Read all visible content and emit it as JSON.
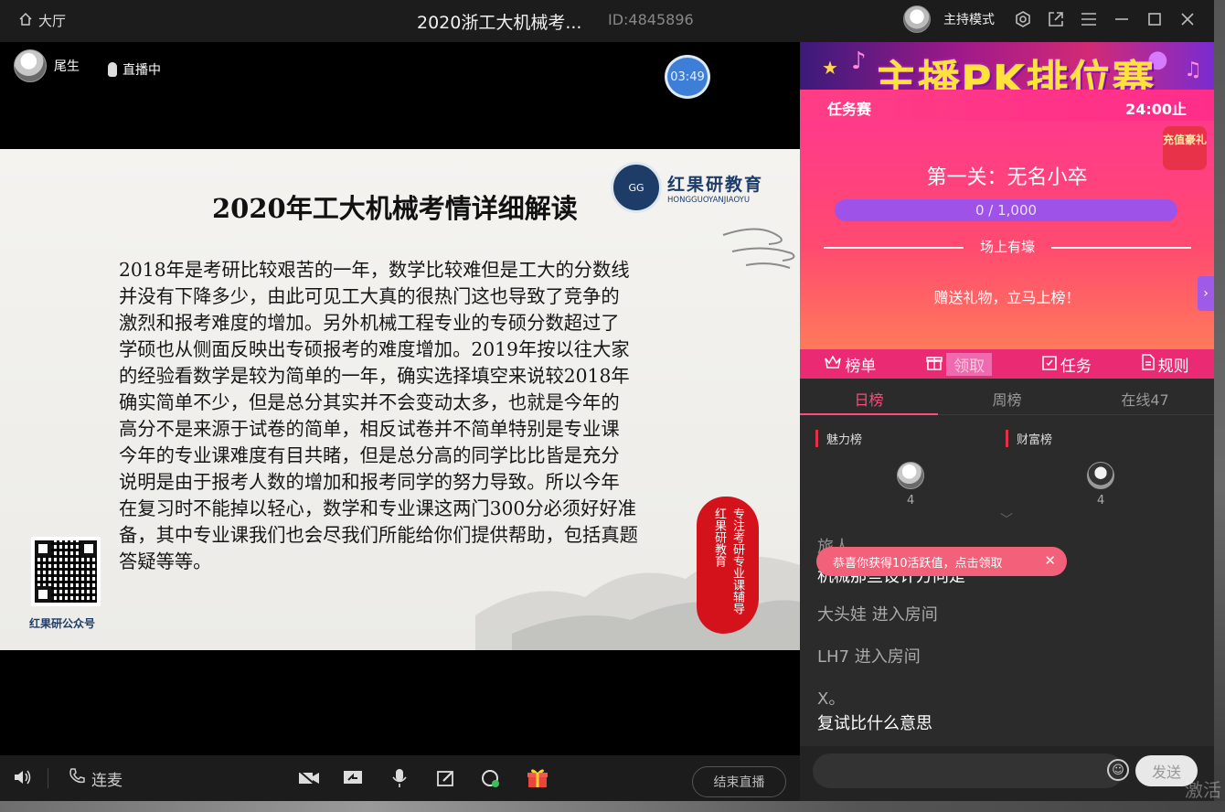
{
  "titlebar": {
    "lobby_label": "大厅",
    "title": "2020浙工大机械考...",
    "room_id": "ID:4845896",
    "mode_label": "主持模式"
  },
  "video": {
    "host_name": "尾生",
    "live_label": "直播中",
    "timer": "03:49"
  },
  "slide": {
    "title": "2020年工大机械考情详细解读",
    "brand_cn": "红果研教育",
    "brand_en": "HONGGUOYANJIAOYU",
    "qr_label": "红果研公众号",
    "seal_col1": "专注考研专业课辅导",
    "seal_col2": "红果研教育",
    "lines": [
      "2018年是考研比较艰苦的一年，数学比较难但是工大的分数线",
      "并没有下降多少，由此可见工大真的很热门这也导致了竞争的",
      "激烈和报考难度的增加。另外机械工程专业的专硕分数超过了",
      "学硕也从侧面反映出专硕报考的难度增加。2019年按以往大家",
      "的经验看数学是较为简单的一年，确实选择填空来说较2018年",
      "确实简单不少，但是总分其实并不会变动太多，也就是今年的",
      "高分不是来源于试卷的简单，相反试卷并不简单特别是专业课",
      "今年的专业课难度有目共睹，但是总分高的同学比比皆是充分",
      "说明是由于报考人数的增加和报考同学的努力导致。所以今年",
      "在复习时不能掉以轻心，数学和专业课这两门300分必须好好准",
      "备，其中专业课我们也会尽我们所能给你们提供帮助，包括真题",
      "答疑等等。"
    ]
  },
  "controls": {
    "connect_label": "连麦",
    "end_live_label": "结束直播"
  },
  "pk": {
    "banner_title": "主播PK排位赛",
    "task_label": "任务赛",
    "deadline": "24:00止",
    "recharge_label": "充值豪礼",
    "level": "第一关：无名小卒",
    "progress": "0 / 1,000",
    "divider_label": "场上有壕",
    "gift_tip": "赠送礼物，立马上榜！",
    "tabs": [
      "榜单",
      "领取",
      "任务",
      "规则"
    ]
  },
  "rank": {
    "tabs": [
      "日榜",
      "周榜",
      "在线47"
    ],
    "charm_title": "魅力榜",
    "wealth_title": "财富榜",
    "charm_count": "4",
    "wealth_count": "4"
  },
  "chat": {
    "toast": "恭喜你获得10活跃值，点击领取",
    "partial_user": "旅人",
    "partial_msg": "机械那些设计方向是",
    "messages": [
      "大头娃 进入房间",
      "LH7 进入房间"
    ],
    "last_user": "X。",
    "last_msg": "复试比什么意思",
    "send_label": "发送"
  },
  "watermark": "激活"
}
